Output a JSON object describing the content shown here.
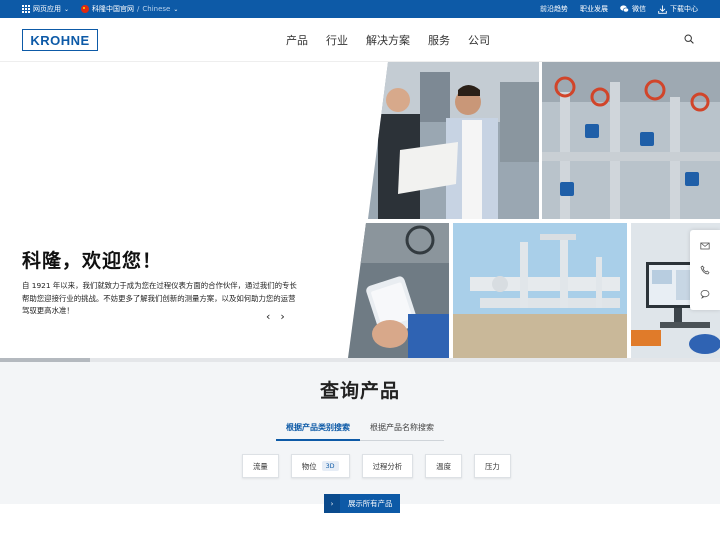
{
  "topbar": {
    "web_apps": "网页应用",
    "site_name": "科隆中国官网",
    "site_lang": "Chinese",
    "news": "前沿趋势",
    "careers": "职业发展",
    "wechat": "微信",
    "downloads": "下载中心"
  },
  "header": {
    "logo": "KROHNE",
    "nav": [
      "产品",
      "行业",
      "解决方案",
      "服务",
      "公司"
    ]
  },
  "hero": {
    "title": "科隆，欢迎您！",
    "description": "自 1921 年以来，我们就致力于成为您在过程仪表方面的合作伙伴，通过我们的专长帮助您迎接行业的挑战。不妨更多了解我们创新的测量方案，以及如何助力您的运营驾驭更高水准！",
    "prev": "‹",
    "next": "›",
    "progress": 0.125
  },
  "product_search": {
    "title": "查询产品",
    "tabs": [
      "根据产品类别搜索",
      "根据产品名称搜索"
    ],
    "active_tab": 0,
    "categories": [
      {
        "label": "流量",
        "badge": ""
      },
      {
        "label": "物位",
        "badge": "3D"
      },
      {
        "label": "过程分析",
        "badge": ""
      },
      {
        "label": "温度",
        "badge": ""
      },
      {
        "label": "压力",
        "badge": ""
      }
    ],
    "show_all": "展示所有产品"
  },
  "colors": {
    "brand": "#0d5aa7",
    "brand_dark": "#0a4a8c",
    "section_bg": "#f3f5f7"
  }
}
